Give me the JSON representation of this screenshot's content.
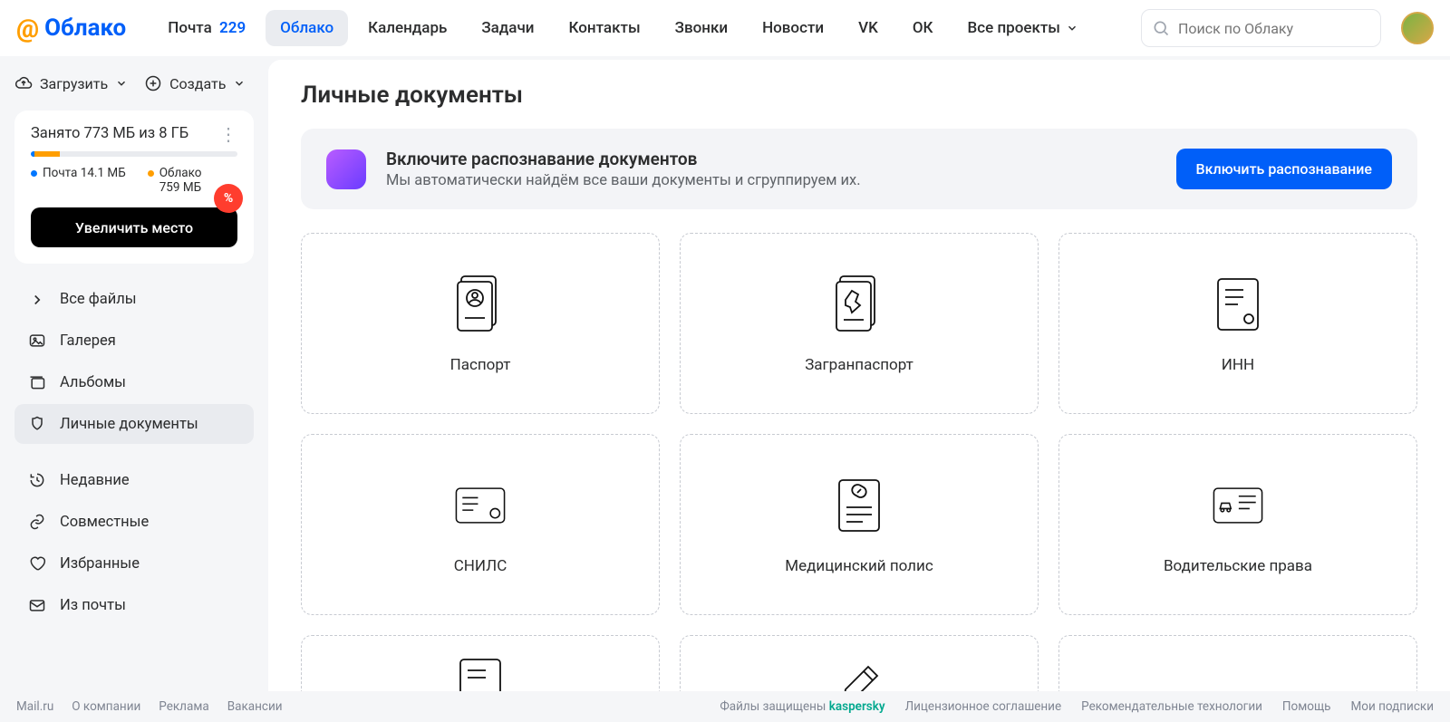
{
  "header": {
    "brand": "Облако",
    "nav": {
      "mail": "Почта",
      "mail_count": "229",
      "cloud": "Облако",
      "calendar": "Календарь",
      "tasks": "Задачи",
      "contacts": "Контакты",
      "calls": "Звонки",
      "news": "Новости",
      "vk": "VK",
      "ok": "ОК",
      "projects": "Все проекты"
    },
    "search_placeholder": "Поиск по Облаку"
  },
  "sidebar": {
    "upload": "Загрузить",
    "create": "Создать",
    "storage": {
      "title": "Занято 773 МБ из 8 ГБ",
      "mail_label": "Почта 14.1 МБ",
      "cloud_label": "Облако",
      "cloud_size": "759 МБ",
      "upgrade": "Увеличить место",
      "badge": "%"
    },
    "items": {
      "all": "Все файлы",
      "gallery": "Галерея",
      "albums": "Альбомы",
      "docs": "Личные документы",
      "recent": "Недавние",
      "shared": "Совместные",
      "fav": "Избранные",
      "frommail": "Из почты"
    }
  },
  "main": {
    "title": "Личные документы",
    "banner": {
      "title": "Включите распознавание документов",
      "desc": "Мы автоматически найдём все ваши документы и сгруппируем их.",
      "cta": "Включить распознавание"
    },
    "cards": {
      "passport": "Паспорт",
      "intpassport": "Загранпаспорт",
      "inn": "ИНН",
      "snils": "СНИЛС",
      "medpolicy": "Медицинский полис",
      "driver": "Водительские права"
    }
  },
  "footer": {
    "mailru": "Mail.ru",
    "about": "О компании",
    "ads": "Реклама",
    "jobs": "Вакансии",
    "protected": "Файлы защищены",
    "kaspersky": "kaspersky",
    "license": "Лицензионное соглашение",
    "reco": "Рекомендательные технологии",
    "help": "Помощь",
    "subs": "Мои подписки"
  }
}
